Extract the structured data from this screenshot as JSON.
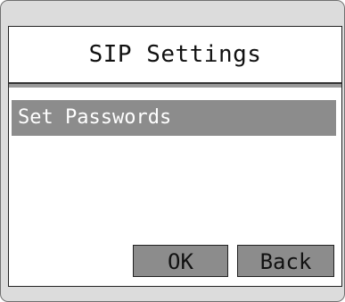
{
  "screen": {
    "title": "SIP Settings",
    "menu": {
      "items": [
        {
          "label": "Set Passwords",
          "selected": true
        }
      ]
    },
    "softkeys": {
      "ok_label": "OK",
      "back_label": "Back"
    }
  },
  "colors": {
    "frame": "#dcdcdc",
    "screen_background": "#ffffff",
    "highlight": "#8c8c8c",
    "divider": "#333333"
  }
}
